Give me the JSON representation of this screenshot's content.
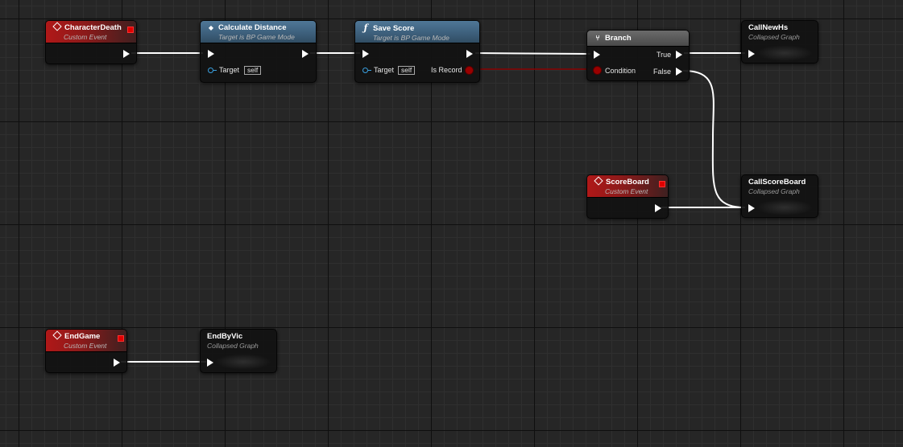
{
  "nodes": {
    "character_death": {
      "title": "CharacterDeath",
      "subtitle": "Custom Event"
    },
    "calc_distance": {
      "title": "Calculate Distance",
      "subtitle": "Target is BP Game Mode",
      "target_label": "Target",
      "target_value": "self"
    },
    "save_score": {
      "title": "Save Score",
      "subtitle": "Target is BP Game Mode",
      "target_label": "Target",
      "target_value": "self",
      "output_label": "Is Record"
    },
    "branch": {
      "title": "Branch",
      "condition_label": "Condition",
      "true_label": "True",
      "false_label": "False"
    },
    "call_new_hs": {
      "title": "CallNewHs",
      "subtitle": "Collapsed Graph"
    },
    "scoreboard": {
      "title": "ScoreBoard",
      "subtitle": "Custom Event"
    },
    "call_scoreboard": {
      "title": "CallScoreBoard",
      "subtitle": "Collapsed Graph"
    },
    "end_game": {
      "title": "EndGame",
      "subtitle": "Custom Event"
    },
    "end_by_vic": {
      "title": "EndByVic",
      "subtitle": "Collapsed Graph"
    }
  },
  "icons": {
    "event": "event-diamond-icon",
    "function": "function-icon",
    "branch": "branch-icon"
  },
  "colors": {
    "event_header": "#b01818",
    "function_header": "#4f7797",
    "branch_header": "#5a5a5a",
    "exec_wire": "#ffffff",
    "bool_wire": "#8a0000",
    "object_pin": "#3aa0e0",
    "background": "#262626"
  }
}
